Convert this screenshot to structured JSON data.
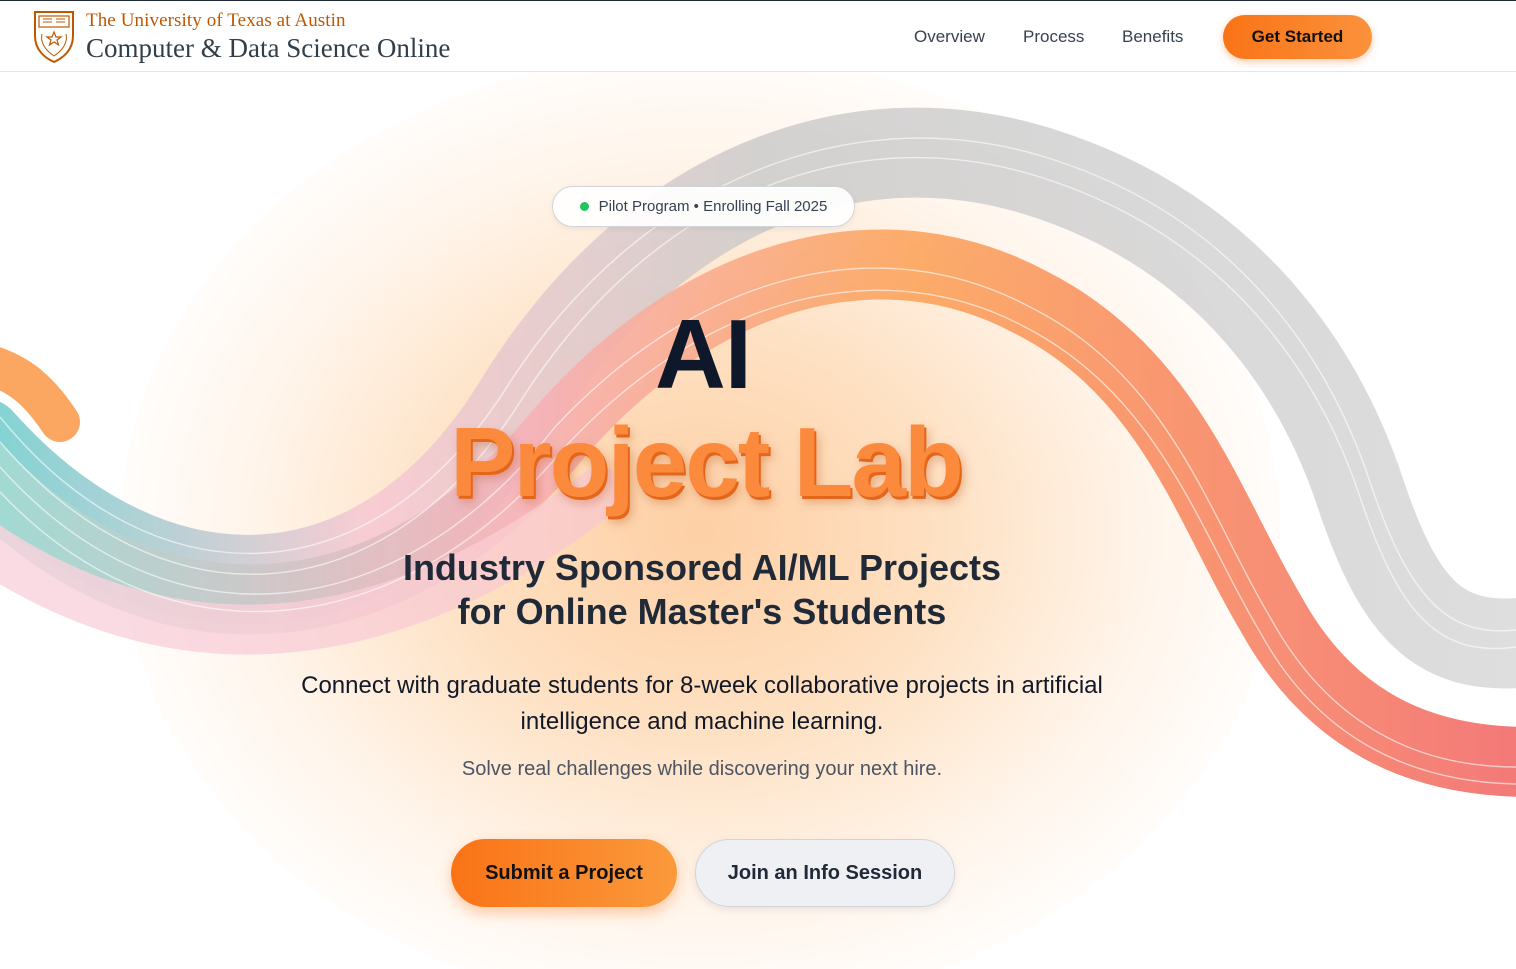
{
  "brand": {
    "university": "The University of Texas at Austin",
    "program": "Computer & Data Science Online",
    "logo_icon": "ut-shield-icon",
    "colors": {
      "burnt_orange": "#bf5700",
      "slate": "#333f48"
    }
  },
  "nav": {
    "links": [
      "Overview",
      "Process",
      "Benefits"
    ],
    "cta_label": "Get Started"
  },
  "hero": {
    "badge": {
      "dot_color": "#22c55e",
      "text": "Pilot Program • Enrolling Fall 2025"
    },
    "title_line1": "AI",
    "title_line2": "Project Lab",
    "subtitle_line1": "Industry Sponsored AI/ML Projects",
    "subtitle_line2": "for Online Master's Students",
    "description": "Connect with graduate students for 8-week collaborative projects in artificial intelligence and machine learning.",
    "tagline": "Solve real challenges while discovering your next hire.",
    "primary_button": "Submit a Project",
    "secondary_button": "Join an Info Session"
  },
  "colors": {
    "accent": "#f97316",
    "accent_light": "#fb923c",
    "heading": "#0f172a"
  }
}
